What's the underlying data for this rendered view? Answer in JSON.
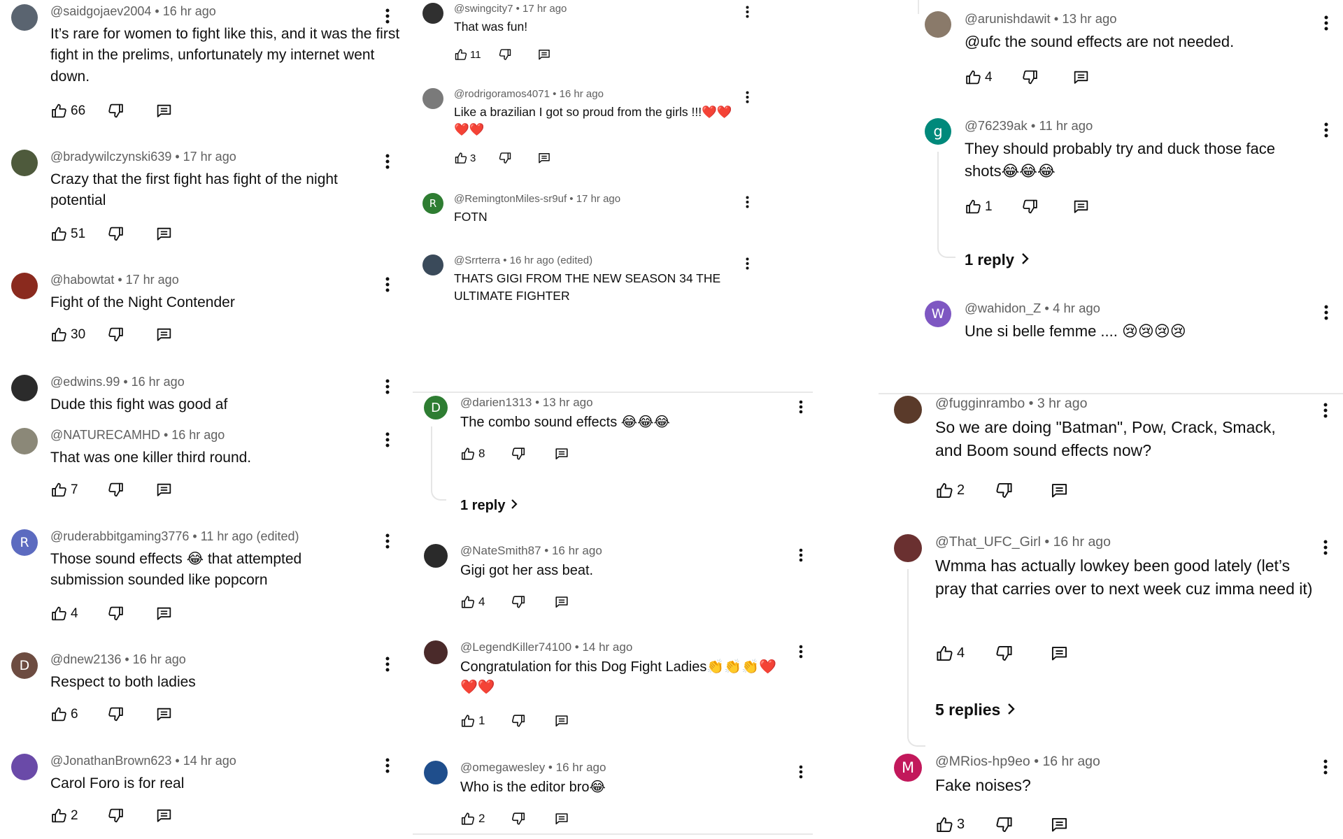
{
  "columns": [
    {
      "comments": [
        {
          "avatar": {
            "letter": "",
            "color": "#5a6470"
          },
          "handle": "@saidgojaev2004",
          "time": "16 hr ago",
          "text": "It’s rare for women to fight like this, and it was the first fight in the prelims, unfortunately my internet went down.",
          "likes": "66"
        },
        {
          "avatar": {
            "letter": "",
            "color": "#4e5a3c"
          },
          "handle": "@bradywilczynski639",
          "time": "17 hr ago",
          "text": "Crazy that the first fight has fight of the night potential",
          "likes": "51"
        },
        {
          "avatar": {
            "letter": "",
            "color": "#8a2a1e"
          },
          "handle": "@habowtat",
          "time": "17 hr ago",
          "text": "Fight of the Night Contender",
          "likes": "30"
        },
        {
          "avatar": {
            "letter": "",
            "color": "#2b2b2b"
          },
          "handle": "@edwins.99",
          "time": "16 hr ago",
          "text": "Dude this fight was good af",
          "likes": ""
        },
        {
          "avatar": {
            "letter": "",
            "color": "#8b8878"
          },
          "handle": "@NATURECAMHD",
          "time": "16 hr ago",
          "text": "That was one killer third round.",
          "likes": "7"
        },
        {
          "avatar": {
            "letter": "R",
            "color": "#5c6bc0"
          },
          "handle": "@ruderabbitgaming3776",
          "time": "11 hr ago (edited)",
          "text": "Those sound effects 😂 that attempted submission sounded like popcorn",
          "likes": "4"
        },
        {
          "avatar": {
            "letter": "D",
            "color": "#6d4c41"
          },
          "handle": "@dnew2136",
          "time": "16 hr ago",
          "text": "Respect to both ladies",
          "likes": "6"
        },
        {
          "avatar": {
            "letter": "",
            "color": "#6a4aa8"
          },
          "handle": "@JonathanBrown623",
          "time": "14 hr ago",
          "text": "Carol Foro is for real",
          "likes": "2"
        }
      ]
    },
    {
      "comments": [
        {
          "avatar": {
            "letter": "",
            "color": "#303030"
          },
          "handle": "@swingcity7",
          "time": "17 hr ago",
          "text": "That was fun!",
          "likes": "11"
        },
        {
          "avatar": {
            "letter": "",
            "color": "#7a7a7a"
          },
          "handle": "@rodrigoramos4071",
          "time": "16 hr ago",
          "text": "Like a brazilian I got so proud from the girls !!!❤️❤️❤️❤️",
          "likes": "3"
        },
        {
          "avatar": {
            "letter": "R",
            "color": "#2e7d32"
          },
          "handle": "@RemingtonMiles-sr9uf",
          "time": "17 hr ago",
          "text": "FOTN",
          "likes": ""
        },
        {
          "avatar": {
            "letter": "",
            "color": "#3a4a5a"
          },
          "handle": "@Srrterra",
          "time": "16 hr ago (edited)",
          "text": "THATS GIGI FROM THE NEW SEASON 34 THE ULTIMATE FIGHTER",
          "likes": ""
        },
        {
          "avatar": {
            "letter": "D",
            "color": "#2e7d32"
          },
          "handle": "@darien1313",
          "time": "13 hr ago",
          "text": "The combo sound effects 😂😂😂",
          "likes": "8",
          "reply_label": "1 reply"
        },
        {
          "avatar": {
            "letter": "",
            "color": "#2a2a2a"
          },
          "handle": "@NateSmith87",
          "time": "16 hr ago",
          "text": "Gigi got her ass beat.",
          "likes": "4"
        },
        {
          "avatar": {
            "letter": "",
            "color": "#4a2a2a"
          },
          "handle": "@LegendKiller74100",
          "time": "14 hr ago",
          "text": "Congratulation for this Dog Fight Ladies👏👏👏❤️❤️❤️",
          "likes": "1"
        },
        {
          "avatar": {
            "letter": "",
            "color": "#1f4e8c"
          },
          "handle": "@omegawesley",
          "time": "16 hr ago",
          "text": "Who is the editor bro😂",
          "likes": "2"
        }
      ]
    },
    {
      "comments": [
        {
          "avatar": {
            "letter": "",
            "color": "#8a7a6a"
          },
          "handle": "@arunishdawit",
          "time": "13 hr ago",
          "text": "@ufc the sound effects are not needed.",
          "likes": "4"
        },
        {
          "avatar": {
            "letter": "g",
            "color": "#00897b"
          },
          "handle": "@76239ak",
          "time": "11 hr ago",
          "text": "They should probably try and duck those face shots😂😂😂",
          "likes": "1",
          "reply_label": "1 reply"
        },
        {
          "avatar": {
            "letter": "W",
            "color": "#7e57c2"
          },
          "handle": "@wahidon_Z",
          "time": "4 hr ago",
          "text": "Une si belle femme .... 😢😢😢😢",
          "likes": ""
        },
        {
          "avatar": {
            "letter": "",
            "color": "#5a3a2a"
          },
          "handle": "@fugginrambo",
          "time": "3 hr ago",
          "text": "So we are doing \"Batman\", Pow, Crack, Smack, and Boom sound effects now?",
          "likes": "2"
        },
        {
          "avatar": {
            "letter": "",
            "color": "#6a3030"
          },
          "handle": "@That_UFC_Girl",
          "time": "16 hr ago",
          "text": "Wmma has actually lowkey been good lately (let’s pray that carries over to next week cuz imma need it)",
          "likes": "4",
          "reply_label": "5 replies"
        },
        {
          "avatar": {
            "letter": "M",
            "color": "#c2185b"
          },
          "handle": "@MRios-hp9eo",
          "time": "16 hr ago",
          "text": "Fake noises?",
          "likes": "3"
        }
      ]
    }
  ]
}
